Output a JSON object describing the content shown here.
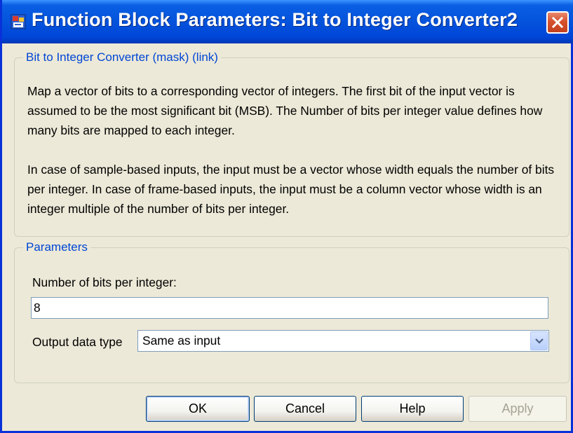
{
  "window": {
    "title": "Function Block Parameters: Bit to Integer Converter2",
    "icon": "simulink-block-icon",
    "close_icon": "close-icon"
  },
  "mask_group": {
    "legend": "Bit to Integer Converter (mask) (link)",
    "description_p1": "Map a vector of bits to a corresponding vector of integers. The first bit of the input vector is assumed to be the most significant bit (MSB). The Number of bits per integer value defines how many bits are mapped to each integer.",
    "description_p2": "In case of sample-based inputs, the input must be a vector whose width equals the number of bits per integer. In case of frame-based inputs, the input must be a column vector whose width is an integer multiple of the number of bits per integer."
  },
  "parameters_group": {
    "legend": "Parameters",
    "bits_label": "Number of bits per integer:",
    "bits_value": "8",
    "output_type_label": "Output data type",
    "output_type_value": "Same as input"
  },
  "buttons": {
    "ok": "OK",
    "cancel": "Cancel",
    "help": "Help",
    "apply": "Apply"
  },
  "colors": {
    "title_bar": "#0453dc",
    "legend_text": "#0046d5",
    "dialog_bg": "#ece9d8"
  }
}
